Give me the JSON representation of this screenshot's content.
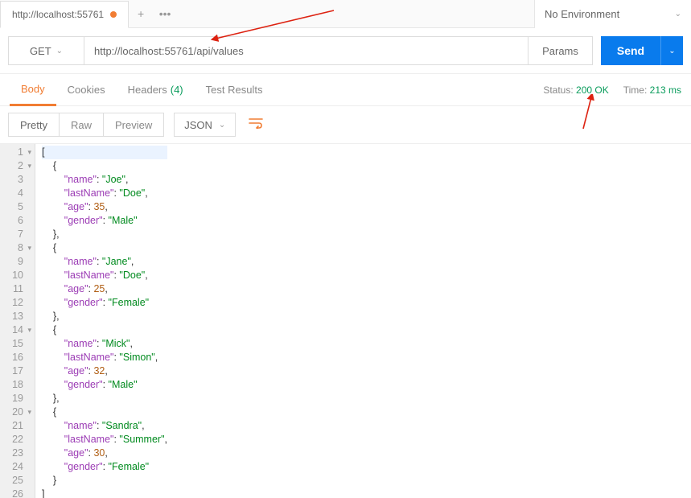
{
  "tab": {
    "title": "http://localhost:55761",
    "unsaved": true
  },
  "env": {
    "label": "No Environment"
  },
  "request": {
    "method": "GET",
    "url": "http://localhost:55761/api/values",
    "params_label": "Params",
    "send_label": "Send"
  },
  "response_tabs": {
    "body": "Body",
    "cookies": "Cookies",
    "headers": "Headers",
    "headers_count": "(4)",
    "tests": "Test Results"
  },
  "status": {
    "status_label": "Status:",
    "status_value": "200 OK",
    "time_label": "Time:",
    "time_value": "213 ms"
  },
  "view": {
    "pretty": "Pretty",
    "raw": "Raw",
    "preview": "Preview",
    "lang": "JSON"
  },
  "body": [
    {
      "name": "Joe",
      "lastName": "Doe",
      "age": 35,
      "gender": "Male"
    },
    {
      "name": "Jane",
      "lastName": "Doe",
      "age": 25,
      "gender": "Female"
    },
    {
      "name": "Mick",
      "lastName": "Simon",
      "age": 32,
      "gender": "Male"
    },
    {
      "name": "Sandra",
      "lastName": "Summer",
      "age": 30,
      "gender": "Female"
    }
  ]
}
